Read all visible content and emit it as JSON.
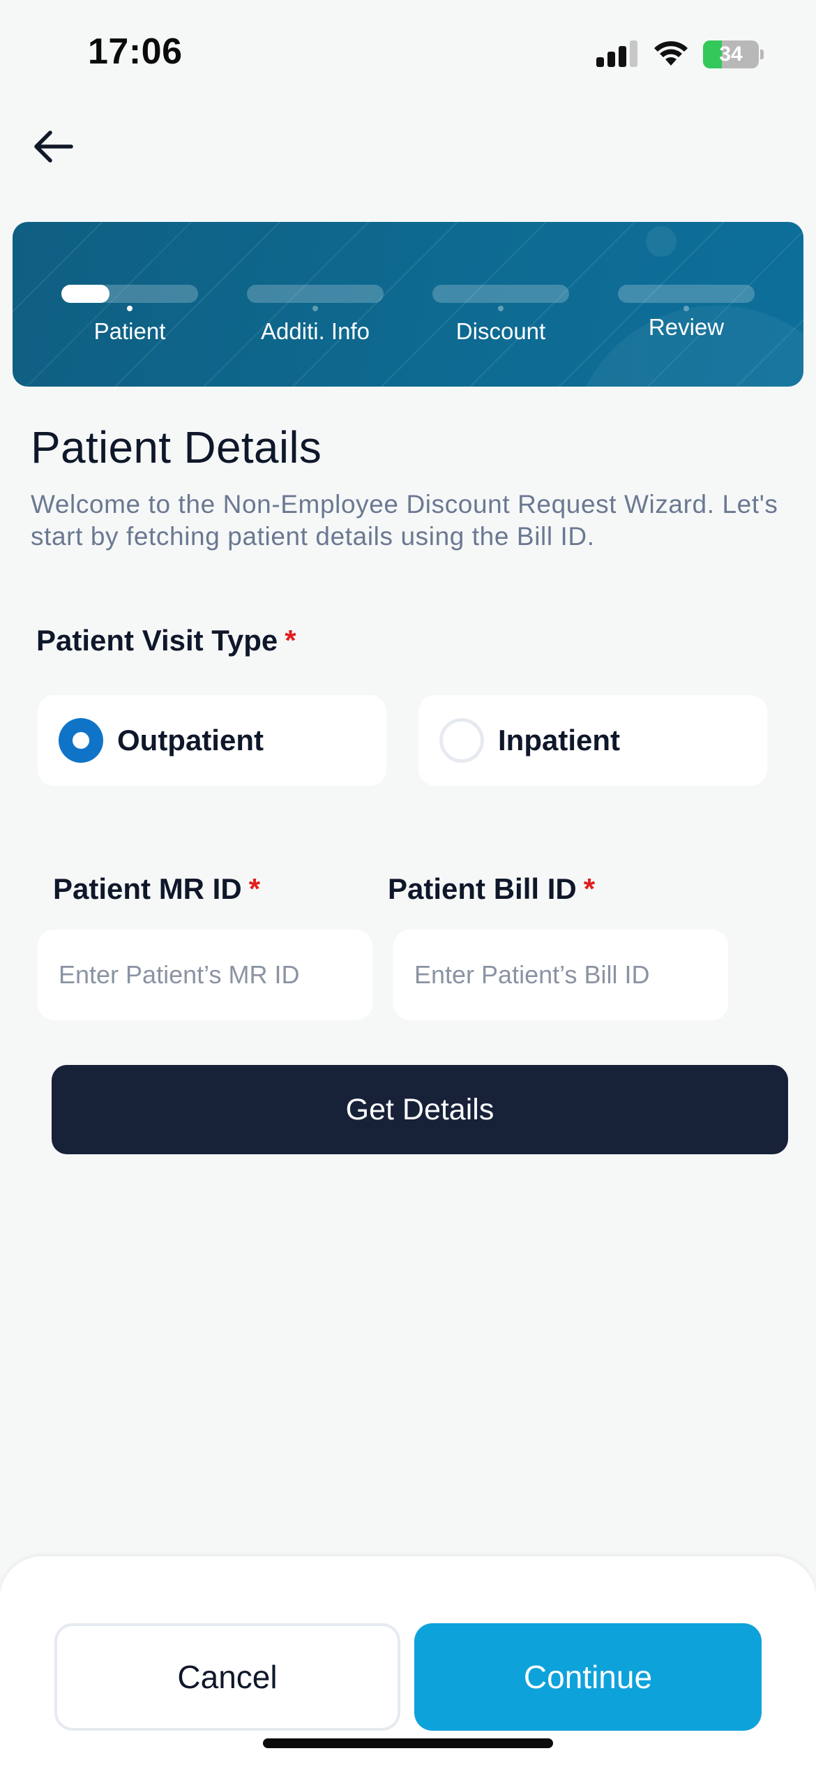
{
  "status_bar": {
    "time": "17:06",
    "battery_level": "34",
    "battery_fraction": 0.34,
    "signal_bars_filled": 3,
    "signal_bars_total": 4
  },
  "header": {
    "back_icon": "arrow-left-icon"
  },
  "stepper": {
    "steps": [
      {
        "label": "Patient",
        "progress": 0.35,
        "active": true
      },
      {
        "label": "Additi. Info",
        "progress": 0,
        "active": false
      },
      {
        "label": "Discount",
        "progress": 0,
        "active": false
      },
      {
        "label": "Review",
        "progress": 0,
        "active": false
      }
    ]
  },
  "page": {
    "title": "Patient Details",
    "subtitle": "Welcome to the Non-Employee Discount Request Wizard. Let's start by fetching patient details using the Bill ID."
  },
  "visit_type": {
    "label": "Patient Visit Type",
    "required_mark": "*",
    "options": [
      {
        "label": "Outpatient",
        "selected": true
      },
      {
        "label": "Inpatient",
        "selected": false
      }
    ]
  },
  "mr_id": {
    "label": "Patient MR ID",
    "required_mark": "*",
    "value": "",
    "placeholder": "Enter Patient’s MR ID"
  },
  "bill_id": {
    "label": "Patient Bill ID",
    "required_mark": "*",
    "value": "",
    "placeholder": "Enter Patient’s Bill ID"
  },
  "actions": {
    "get_details": "Get Details",
    "cancel": "Cancel",
    "continue": "Continue"
  },
  "colors": {
    "accent": "#0ea2db",
    "banner": "#0e6a91",
    "dark_button": "#172138",
    "radio_selected": "#0f74c8",
    "required": "#e11d1d"
  }
}
